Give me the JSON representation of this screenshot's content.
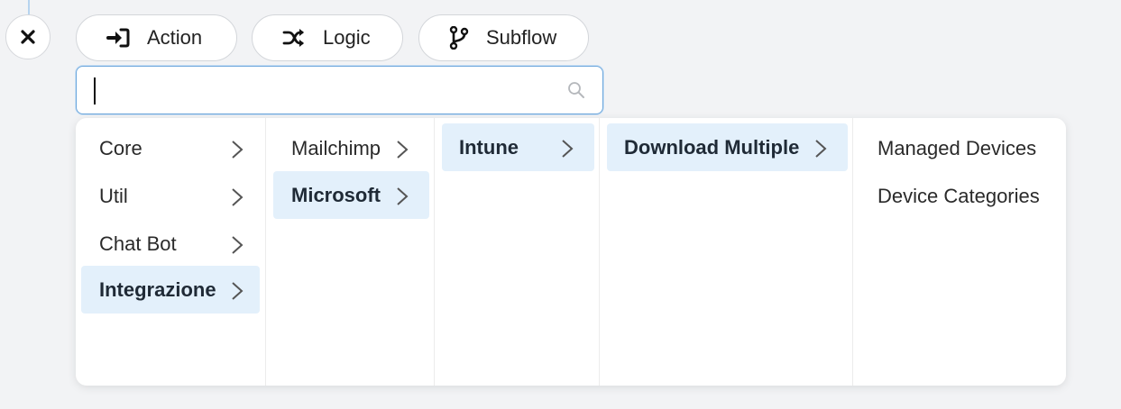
{
  "toolbar": {
    "action_label": "Action",
    "logic_label": "Logic",
    "subflow_label": "Subflow"
  },
  "search": {
    "value": "",
    "placeholder": ""
  },
  "menu": {
    "col1": [
      "Core",
      "Util",
      "Chat Bot",
      "Integrazione"
    ],
    "col2": [
      "Mailchimp",
      "Microsoft"
    ],
    "col3": [
      "Intune"
    ],
    "col4": [
      "Download Multiple"
    ],
    "col5": [
      "Managed Devices",
      "Device Categories"
    ],
    "selected": {
      "col1": "Integrazione",
      "col2": "Microsoft",
      "col3": "Intune",
      "col4": "Download Multiple"
    }
  },
  "colors": {
    "selected_bg": "#e3f0fb",
    "search_border": "#6aa5dc",
    "background": "#f2f3f5"
  }
}
